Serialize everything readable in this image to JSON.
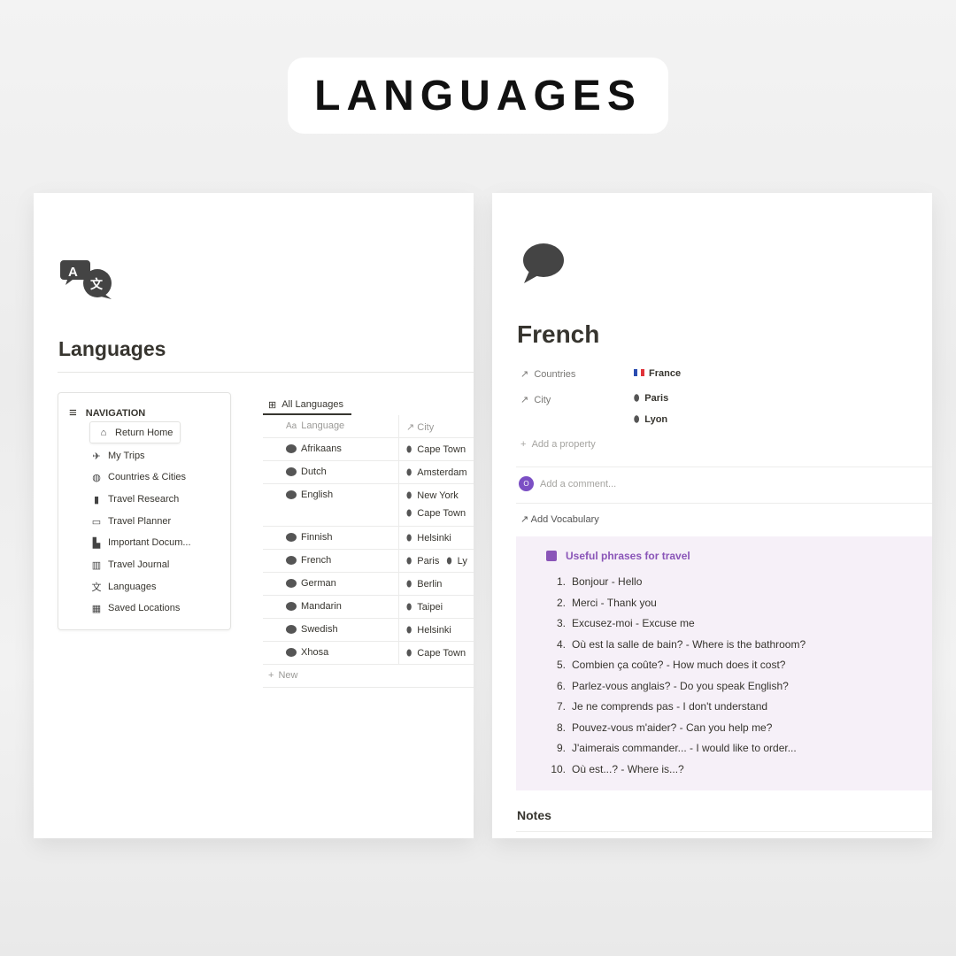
{
  "banner": {
    "title": "LANGUAGES"
  },
  "left": {
    "page_icon": "translate-icon",
    "title": "Languages",
    "nav": {
      "heading": "NAVIGATION",
      "items": [
        {
          "label": "Return Home",
          "icon": "house-icon"
        },
        {
          "label": "My Trips",
          "icon": "airplane-icon"
        },
        {
          "label": "Countries & Cities",
          "icon": "globe-icon"
        },
        {
          "label": "Travel Research",
          "icon": "book-icon"
        },
        {
          "label": "Travel Planner",
          "icon": "calendar-icon"
        },
        {
          "label": "Important Docum...",
          "icon": "document-icon"
        },
        {
          "label": "Travel Journal",
          "icon": "open-book-icon"
        },
        {
          "label": "Languages",
          "icon": "translate-icon"
        },
        {
          "label": "Saved Locations",
          "icon": "map-icon"
        }
      ]
    },
    "table": {
      "tab": "All Languages",
      "headers": [
        "Language",
        "City"
      ],
      "rows": [
        {
          "language": "Afrikaans",
          "cities": [
            "Cape Town"
          ]
        },
        {
          "language": "Dutch",
          "cities": [
            "Amsterdam"
          ]
        },
        {
          "language": "English",
          "cities": [
            "New York",
            "Cape Town"
          ]
        },
        {
          "language": "Finnish",
          "cities": [
            "Helsinki"
          ]
        },
        {
          "language": "French",
          "cities": [
            "Paris",
            "Ly"
          ]
        },
        {
          "language": "German",
          "cities": [
            "Berlin"
          ]
        },
        {
          "language": "Mandarin",
          "cities": [
            "Taipei"
          ]
        },
        {
          "language": "Swedish",
          "cities": [
            "Helsinki"
          ]
        },
        {
          "language": "Xhosa",
          "cities": [
            "Cape Town"
          ]
        }
      ],
      "new_label": "New"
    }
  },
  "right": {
    "page_icon": "speech-bubble-icon",
    "title": "French",
    "props": {
      "countries_label": "Countries",
      "countries_value": "France",
      "city_label": "City",
      "cities": [
        "Paris",
        "Lyon"
      ],
      "add_property": "Add a property"
    },
    "comment": {
      "avatar": "O",
      "placeholder": "Add a comment..."
    },
    "add_vocab": "Add Vocabulary",
    "callout": {
      "title": "Useful phrases for travel",
      "accent": "#8a55b8",
      "items": [
        "Bonjour - Hello",
        "Merci - Thank you",
        "Excusez-moi - Excuse me",
        "Où est la salle de bain? - Where is the bathroom?",
        "Combien ça coûte? - How much does it cost?",
        "Parlez-vous anglais? - Do you speak English?",
        "Je ne comprends pas - I don't understand",
        "Pouvez-vous m'aider? - Can you help me?",
        "J'aimerais commander... - I would like to order...",
        "Où est...? - Where is...?"
      ]
    },
    "notes": "Notes"
  }
}
